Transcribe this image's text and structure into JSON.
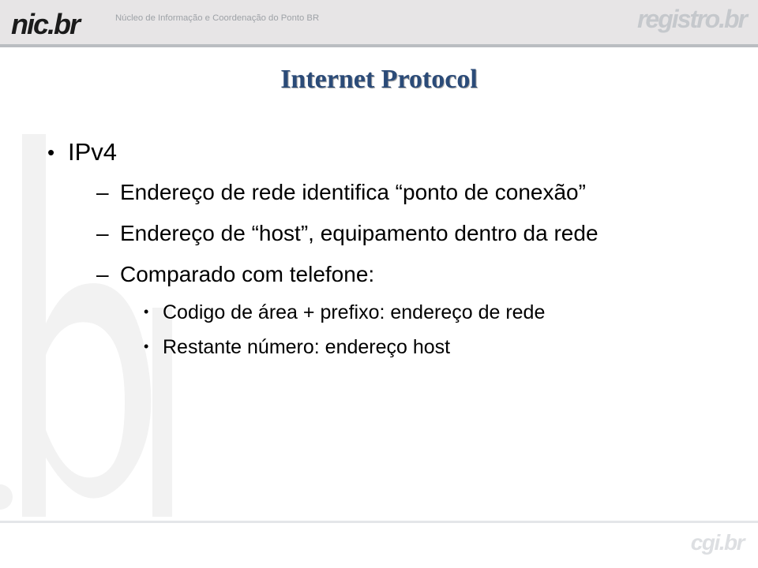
{
  "header": {
    "logo_nic": "nic.br",
    "tagline": "Núcleo de Informação e Coordenação do Ponto BR",
    "logo_registro": "registro.br"
  },
  "slide": {
    "title": "Internet Protocol",
    "bullets": {
      "lvl1": "IPv4",
      "lvl2_a": "Endereço de rede identifica \"ponto de conexão\"",
      "lvl2_b": "Endereço de \"host\", equipamento dentro da rede",
      "lvl2_c": "Comparado com telefone:",
      "lvl3_a": "Codigo de área + prefixo: endereço de rede",
      "lvl3_b": "Restante número: endereço host"
    }
  },
  "footer": {
    "logo_cgi": "cgi.br"
  }
}
